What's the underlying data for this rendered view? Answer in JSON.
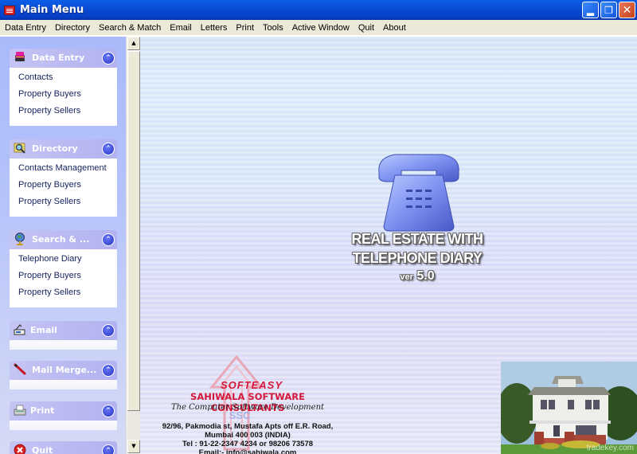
{
  "window": {
    "title": "Main Menu",
    "app_icon": "telephone-icon",
    "controls": {
      "minimize": "minimize-icon",
      "restore": "restore-icon",
      "close": "close-icon"
    }
  },
  "menubar": {
    "items": [
      {
        "label": "Data Entry"
      },
      {
        "label": "Directory"
      },
      {
        "label": "Search & Match"
      },
      {
        "label": "Email"
      },
      {
        "label": "Letters"
      },
      {
        "label": "Print"
      },
      {
        "label": "Tools"
      },
      {
        "label": "Active Window"
      },
      {
        "label": "Quit"
      },
      {
        "label": "About"
      }
    ]
  },
  "taskpane": {
    "groups": [
      {
        "title": "Data Entry",
        "icon": "books-icon",
        "links": [
          "Contacts",
          "Property Buyers",
          "Property Sellers"
        ]
      },
      {
        "title": "Directory",
        "icon": "magnifier-folder-icon",
        "links": [
          "Contacts Management",
          "Property Buyers",
          "Property Sellers"
        ]
      },
      {
        "title": "Search & ...",
        "icon": "globe-icon",
        "links": [
          "Telephone Diary",
          "Property Buyers",
          "Property Sellers"
        ]
      },
      {
        "title": "Email",
        "icon": "email-icon",
        "links": []
      },
      {
        "title": "Mail Merge...",
        "icon": "pen-icon",
        "links": []
      },
      {
        "title": "Print",
        "icon": "printer-icon",
        "links": []
      },
      {
        "title": "Quit",
        "icon": "quit-icon",
        "links": []
      }
    ]
  },
  "splash": {
    "product_line1": "REAL ESTATE WITH",
    "product_line2": "TELEPHONE DIARY",
    "version_prefix": "ver",
    "version": "5.0"
  },
  "company": {
    "brand": "SOFTEASY",
    "name": "SAHIWALA SOFTWARE CONSULTANTS",
    "tagline": "The Computer Software Development",
    "mark": "SSC",
    "address_line1": "92/96, Pakmodia st, Mustafa Apts off E.R. Road,",
    "address_line2": "Mumbai 400 003 (INDIA)",
    "phone": "Tel : 91-22-2347 4234 or 98206 73578",
    "email": "Email:- info@sahiwala.com"
  },
  "photo": {
    "subject": "house-photo",
    "watermark": "tradekey.com"
  }
}
